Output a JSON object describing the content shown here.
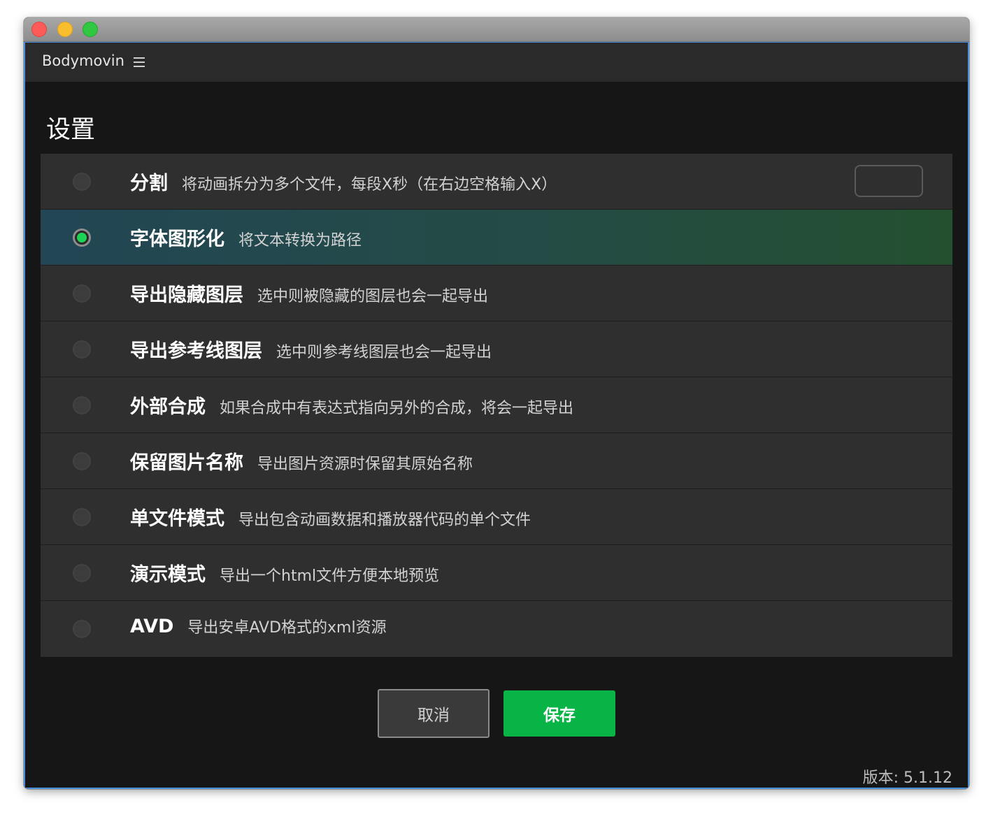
{
  "window": {
    "controls": [
      "close",
      "minimize",
      "zoom"
    ]
  },
  "appbar": {
    "app_name": "Bodymovin",
    "menu_icon": "hamburger-menu-icon"
  },
  "page": {
    "title": "设置"
  },
  "settings": [
    {
      "title": "分割",
      "description": "将动画拆分为多个文件，每段X秒（在右边空格输入X）",
      "selected": false,
      "input_value": ""
    },
    {
      "title": "字体图形化",
      "description": "将文本转换为路径",
      "selected": true
    },
    {
      "title": "导出隐藏图层",
      "description": "选中则被隐藏的图层也会一起导出",
      "selected": false
    },
    {
      "title": "导出参考线图层",
      "description": "选中则参考线图层也会一起导出",
      "selected": false
    },
    {
      "title": "外部合成",
      "description": "如果合成中有表达式指向另外的合成，将会一起导出",
      "selected": false
    },
    {
      "title": "保留图片名称",
      "description": "导出图片资源时保留其原始名称",
      "selected": false
    },
    {
      "title": "单文件模式",
      "description": "导出包含动画数据和播放器代码的单个文件",
      "selected": false
    },
    {
      "title": "演示模式",
      "description": "导出一个html文件方便本地预览",
      "selected": false
    },
    {
      "title": "AVD",
      "description": "导出安卓AVD格式的xml资源",
      "selected": false
    }
  ],
  "buttons": {
    "cancel_label": "取消",
    "save_label": "保存"
  },
  "footer": {
    "version": "版本: 5.1.12"
  },
  "colors": {
    "accent_green": "#08b445",
    "radio_on": "#1ed254",
    "panel_bg": "#2f2f2f",
    "window_bg": "#161616"
  }
}
